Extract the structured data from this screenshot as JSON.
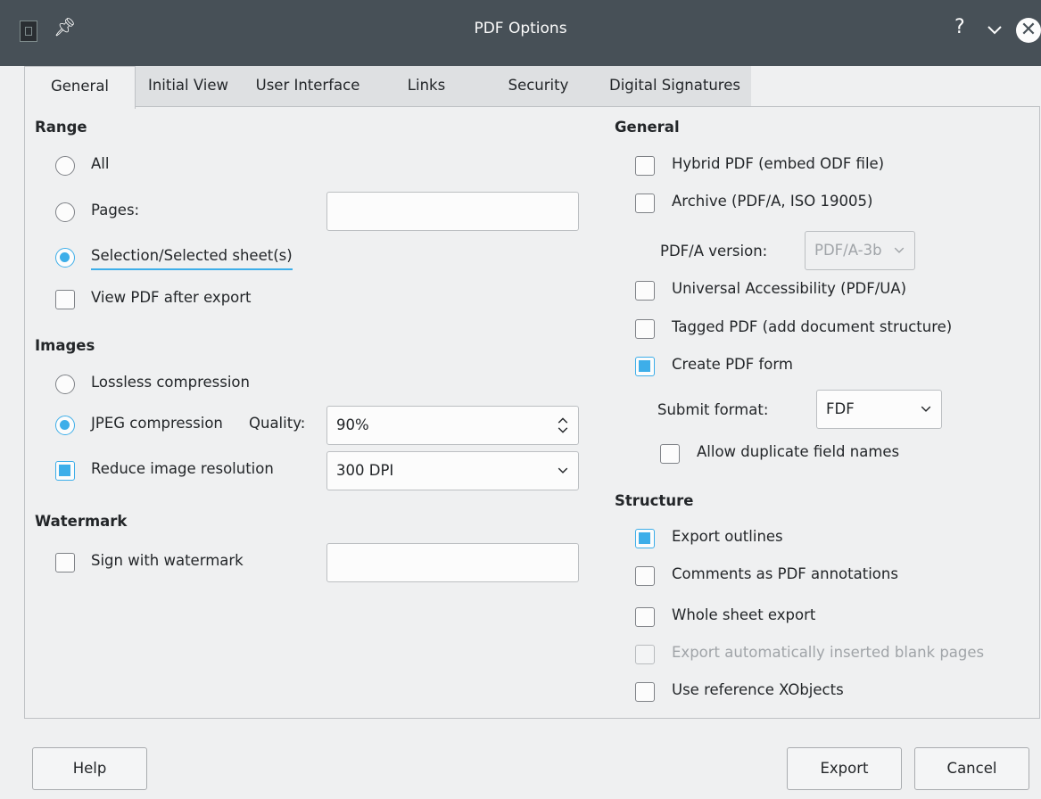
{
  "window": {
    "title": "PDF Options",
    "icons": {
      "app": "app-icon",
      "pin": "pin-icon",
      "help": "help-icon",
      "minimize": "chevron-down-icon",
      "close": "close-icon"
    }
  },
  "tabs": [
    {
      "label": "General",
      "active": true
    },
    {
      "label": "Initial View"
    },
    {
      "label": "User Interface"
    },
    {
      "label": "Links"
    },
    {
      "label": "Security"
    },
    {
      "label": "Digital Signatures"
    }
  ],
  "range": {
    "heading": "Range",
    "all_label": "All",
    "pages_label": "Pages:",
    "pages_value": "",
    "selection_label": "Selection/Selected sheet(s)",
    "selected": "selection",
    "view_after_label": "View PDF after export",
    "view_after_checked": false
  },
  "images": {
    "heading": "Images",
    "lossless_label": "Lossless compression",
    "jpeg_label": "JPEG compression",
    "quality_label": "Quality:",
    "quality_value": "90%",
    "selected": "jpeg",
    "reduce_label": "Reduce image resolution",
    "reduce_checked": true,
    "resolution_value": "300 DPI"
  },
  "watermark": {
    "heading": "Watermark",
    "sign_label": "Sign with watermark",
    "sign_checked": false,
    "text_value": ""
  },
  "general": {
    "heading": "General",
    "hybrid_label": "Hybrid PDF (embed ODF file)",
    "archive_label": "Archive (PDF/A, ISO 19005)",
    "pdfa_version_label": "PDF/A version:",
    "pdfa_version_value": "PDF/A-3b",
    "ua_label": "Universal Accessibility (PDF/UA)",
    "tagged_label": "Tagged PDF (add document structure)",
    "form_label": "Create PDF form",
    "form_checked": true,
    "submit_format_label": "Submit format:",
    "submit_format_value": "FDF",
    "duplicate_label": "Allow duplicate field names"
  },
  "structure": {
    "heading": "Structure",
    "outlines_label": "Export outlines",
    "outlines_checked": true,
    "comments_label": "Comments as PDF annotations",
    "whole_sheet_label": "Whole sheet export",
    "blank_pages_label": "Export automatically inserted blank pages",
    "xobjects_label": "Use reference XObjects"
  },
  "buttons": {
    "help": "Help",
    "export": "Export",
    "cancel": "Cancel"
  },
  "colors": {
    "accent": "#3daee9",
    "titlebar": "#475057",
    "background": "#eff0f1"
  }
}
